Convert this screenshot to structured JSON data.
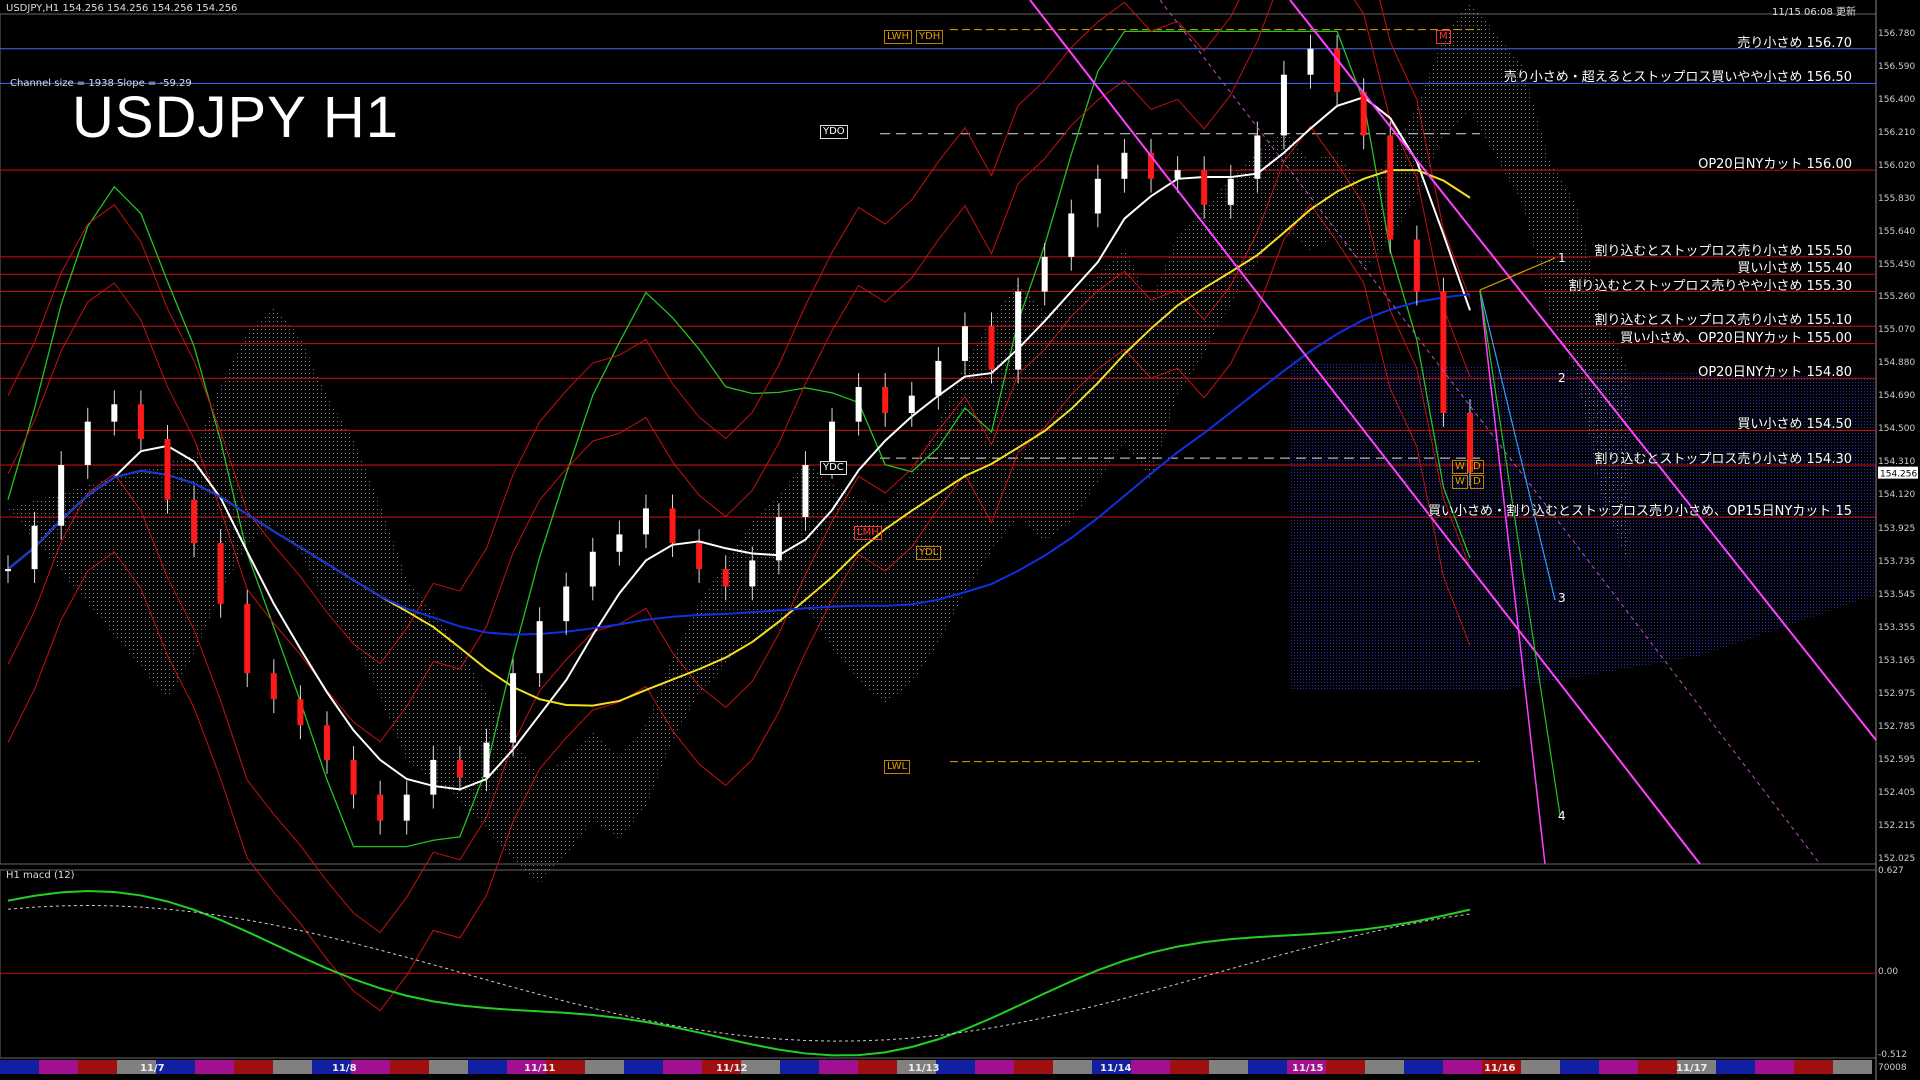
{
  "header": {
    "symbol_info": "USDJPY,H1  154.256 154.256 154.256 154.256",
    "update_time": "11/15 06:08 更新",
    "channel_info": "Channel size = 1938 Slope = -59.29",
    "title": "USDJPY H1",
    "macd_label": "H1  macd (12)"
  },
  "levels": [
    {
      "label": "売り小さめ 156.70",
      "price": 156.7
    },
    {
      "label": "売り小さめ・超えるとストップロス買いやや小さめ 156.50",
      "price": 156.5
    },
    {
      "label": "OP20日NYカット 156.00",
      "price": 156.0
    },
    {
      "label": "割り込むとストップロス売り小さめ 155.50",
      "price": 155.5
    },
    {
      "label": "買い小さめ 155.40",
      "price": 155.4
    },
    {
      "label": "割り込むとストップロス売りやや小さめ 155.30",
      "price": 155.3
    },
    {
      "label": "割り込むとストップロス売り小さめ 155.10",
      "price": 155.1
    },
    {
      "label": "買い小さめ、OP20日NYカット 155.00",
      "price": 155.0
    },
    {
      "label": "OP20日NYカット 154.80",
      "price": 154.8
    },
    {
      "label": "買い小さめ 154.50",
      "price": 154.5
    },
    {
      "label": "割り込むとストップロス売り小さめ 154.30",
      "price": 154.3
    },
    {
      "label": "買い小さめ・割り込むとストップロス売り小さめ、OP15日NYカット 15",
      "price": 154.0
    }
  ],
  "price_tags": {
    "lwh": "LWH",
    "ydh": "YDH",
    "ydo": "YDO",
    "ydc": "YDC",
    "lmh": "LMH",
    "ydl": "YDL",
    "lwl": "LWL",
    "m": "M",
    "w1": "W",
    "d1": "D",
    "w2": "W",
    "d2": "D"
  },
  "channel_numbers": [
    "1",
    "2",
    "3",
    "4"
  ],
  "chart_data": {
    "type": "line",
    "title": "USDJPY H1",
    "symbol": "USDJPY",
    "timeframe": "H1",
    "ylim": [
      152.0,
      156.9
    ],
    "y_ticks": [
      "156.780",
      "156.590",
      "156.400",
      "156.210",
      "156.020",
      "155.830",
      "155.640",
      "155.450",
      "155.260",
      "155.070",
      "154.880",
      "154.690",
      "154.500",
      "154.310",
      "154.120",
      "153.925",
      "153.735",
      "153.545",
      "153.355",
      "153.165",
      "152.975",
      "152.785",
      "152.595",
      "152.405",
      "152.215",
      "152.025"
    ],
    "current_price": "154.256",
    "x_dates": [
      "11/7",
      "11/8",
      "11/11",
      "11/12",
      "11/13",
      "11/14",
      "11/15",
      "11/16",
      "11/17"
    ],
    "price_series": [
      {
        "date": "11/7",
        "values": [
          153.7,
          153.95,
          154.3,
          154.55,
          154.65,
          154.45,
          154.1,
          153.85
        ]
      },
      {
        "date": "11/8",
        "values": [
          153.5,
          153.1,
          152.95,
          152.8,
          152.6,
          152.4,
          152.25,
          152.4
        ]
      },
      {
        "date": "11/11",
        "values": [
          152.6,
          152.5,
          152.7,
          153.1,
          153.4,
          153.6,
          153.8,
          153.9
        ]
      },
      {
        "date": "11/12",
        "values": [
          154.05,
          153.85,
          153.7,
          153.6,
          153.75,
          154.0,
          154.3,
          154.55
        ]
      },
      {
        "date": "11/13",
        "values": [
          154.75,
          154.6,
          154.7,
          154.9,
          155.1,
          154.85,
          155.3,
          155.5
        ]
      },
      {
        "date": "11/14",
        "values": [
          155.75,
          155.95,
          156.1,
          155.95,
          156.0,
          155.8,
          155.95,
          156.2
        ]
      },
      {
        "date": "11/15",
        "values": [
          156.55,
          156.7,
          156.45,
          156.2,
          155.6,
          155.3,
          154.6,
          154.26
        ]
      }
    ],
    "macd": {
      "ylim": [
        -0.512,
        0.627
      ],
      "ticks": [
        "0.627",
        "0.00",
        "-0.512"
      ]
    },
    "volume_label": "70008"
  }
}
